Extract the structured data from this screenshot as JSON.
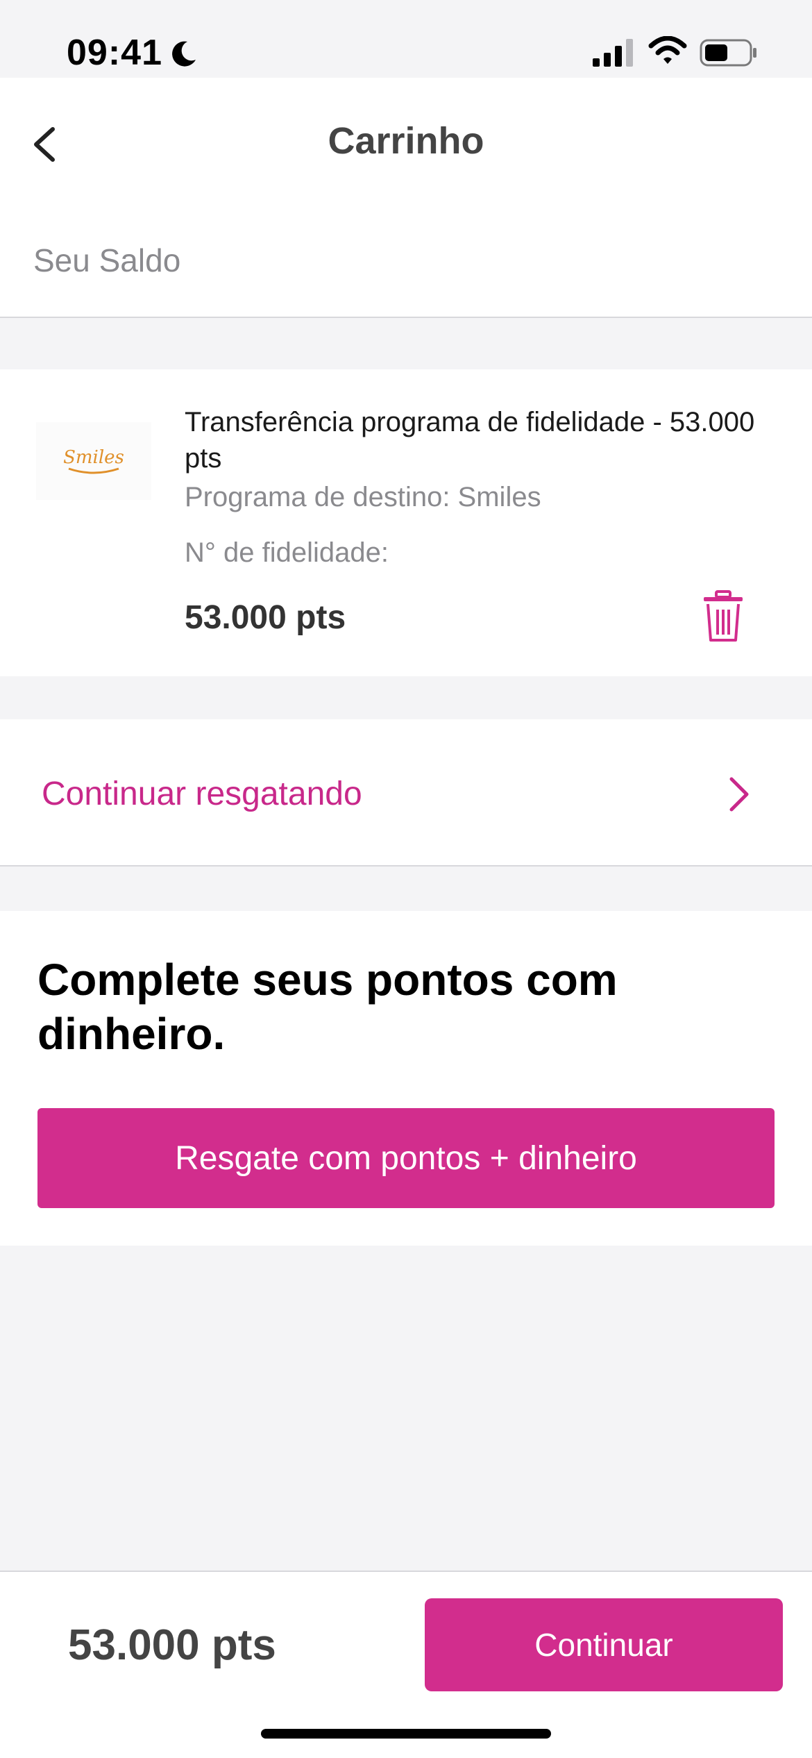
{
  "status_bar": {
    "time": "09:41"
  },
  "header": {
    "title": "Carrinho",
    "balance_label": "Seu Saldo"
  },
  "cart_item": {
    "title": "Transferência programa de fidelidade - 53.000 pts",
    "destination": "Programa de destino: Smiles",
    "loyalty_number": "N° de fidelidade:",
    "points": "53.000 pts",
    "logo_text": "Smiles"
  },
  "continue_redeeming": {
    "label": "Continuar resgatando"
  },
  "complete_section": {
    "heading": "Complete seus pontos com dinheiro.",
    "button_label": "Resgate com pontos + dinheiro"
  },
  "footer": {
    "total": "53.000 pts",
    "continue_label": "Continuar"
  },
  "colors": {
    "accent": "#d22d8d",
    "link": "#c8288a",
    "background": "#f4f4f6",
    "logo": "#e0902a"
  }
}
